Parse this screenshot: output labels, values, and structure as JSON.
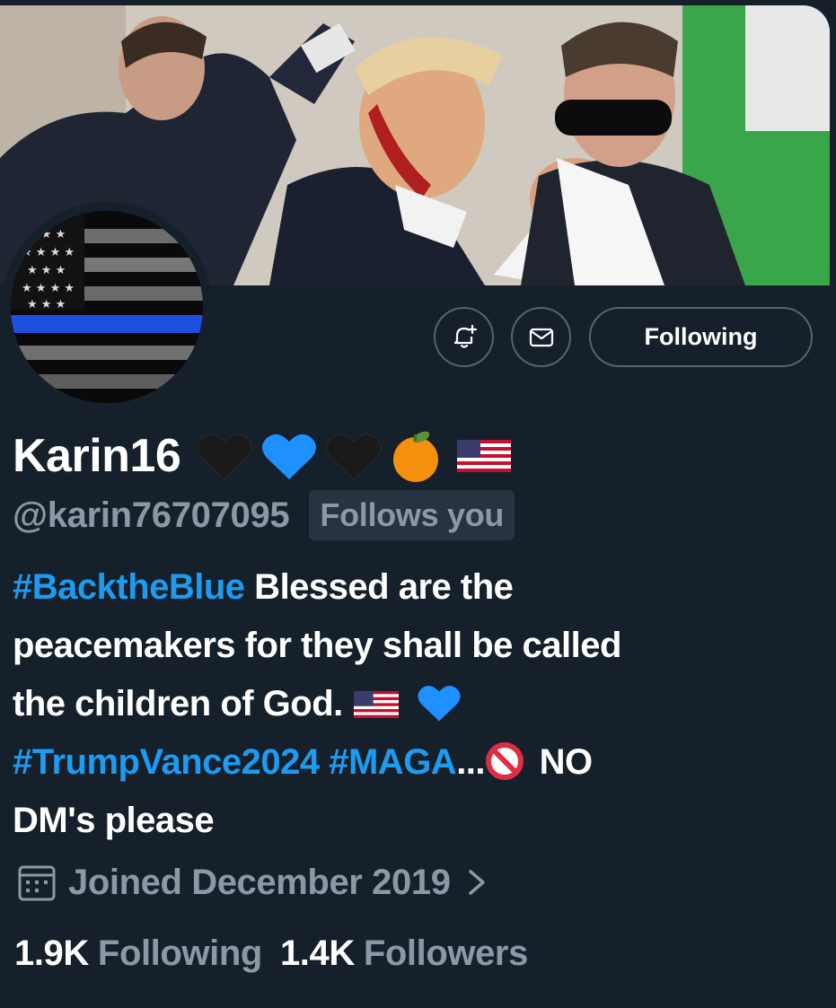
{
  "banner": {
    "description_icon": "banner-photo"
  },
  "avatar": {
    "icon": "thin-blue-line-flag"
  },
  "actions": {
    "notify_icon": "bell-plus-icon",
    "message_icon": "envelope-icon",
    "follow_label": "Following"
  },
  "profile": {
    "display_name": "Karin16",
    "name_emojis": [
      "black-heart",
      "blue-heart",
      "black-heart",
      "tangerine",
      "us-flag"
    ],
    "handle": "@karin76707095",
    "follows_you_label": "Follows you"
  },
  "bio": {
    "line1_hashtag": "#BacktheBlue",
    "line1_text": " Blessed are the",
    "line2_text": "peacemakers for they shall be called",
    "line3_text": "the children of God.",
    "line4_hashtag1": "#TrumpVance2024",
    "line4_space": " ",
    "line4_hashtag2": "#MAGA",
    "line4_ellipsis": "...",
    "line4_text": " NO",
    "line5_text": "DM's please"
  },
  "joined": {
    "label": "Joined December 2019"
  },
  "stats": {
    "following_count": "1.9K",
    "following_label": "Following",
    "followers_count": "1.4K",
    "followers_label": "Followers"
  },
  "colors": {
    "background": "#15202b",
    "accent": "#1d9bf0",
    "secondary_text": "#8b98a5",
    "border": "#536471"
  }
}
